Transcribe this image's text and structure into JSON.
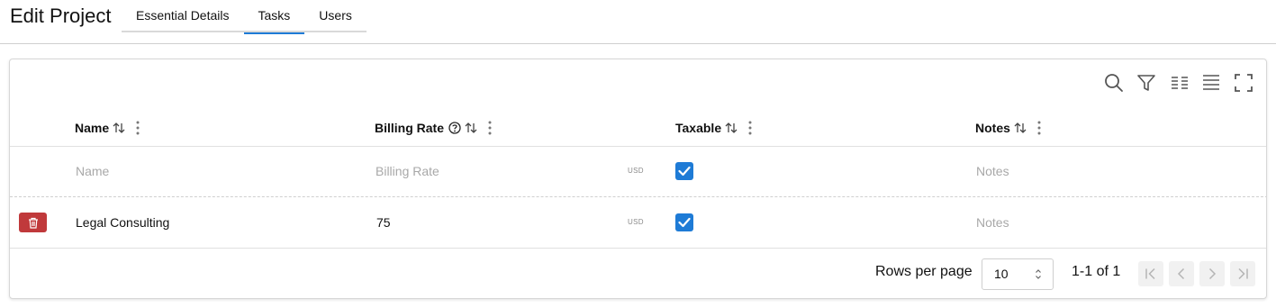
{
  "page": {
    "title": "Edit Project"
  },
  "tabs": [
    {
      "label": "Essential Details",
      "active": false
    },
    {
      "label": "Tasks",
      "active": true
    },
    {
      "label": "Users",
      "active": false
    }
  ],
  "toolbar": {
    "icons": [
      "search-icon",
      "filter-icon",
      "columns-icon",
      "density-icon",
      "fullscreen-icon"
    ]
  },
  "table": {
    "columns": [
      {
        "label": "Name",
        "sortable": true,
        "help": false
      },
      {
        "label": "Billing Rate",
        "sortable": true,
        "help": true
      },
      {
        "label": "Taxable",
        "sortable": true,
        "help": false
      },
      {
        "label": "Notes",
        "sortable": true,
        "help": false
      }
    ],
    "new_row": {
      "name_placeholder": "Name",
      "billing_rate_placeholder": "Billing Rate",
      "currency": "USD",
      "taxable": true,
      "notes_placeholder": "Notes"
    },
    "rows": [
      {
        "name": "Legal Consulting",
        "billing_rate": "75",
        "currency": "USD",
        "taxable": true,
        "notes_placeholder": "Notes"
      }
    ]
  },
  "pagination": {
    "rows_per_page_label": "Rows per page",
    "rows_per_page_value": "10",
    "range_text": "1-1 of 1"
  },
  "colors": {
    "accent": "#1e7bd6",
    "danger": "#c0393b",
    "border": "#d7d7d7"
  }
}
